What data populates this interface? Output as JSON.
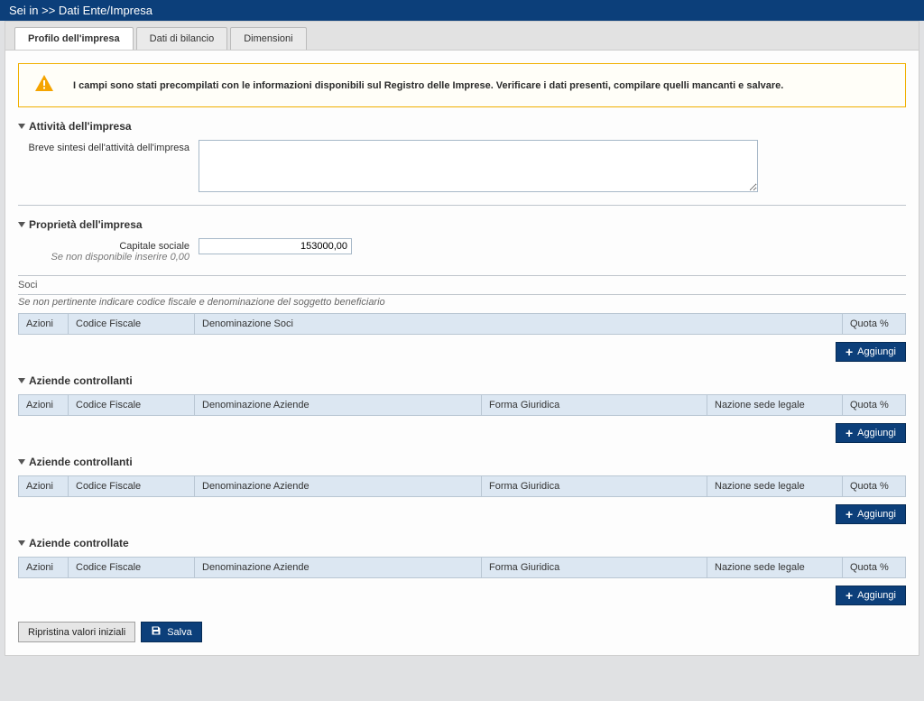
{
  "header": {
    "breadcrumb": "Sei in >> Dati Ente/Impresa"
  },
  "tabs": {
    "profilo": "Profilo dell'impresa",
    "dati": "Dati di bilancio",
    "dimensioni": "Dimensioni"
  },
  "info": {
    "text": "I campi sono stati precompilati con le informazioni disponibili sul Registro delle Imprese. Verificare i dati presenti, compilare quelli mancanti e salvare."
  },
  "section_attivita": {
    "title": "Attività dell'impresa",
    "field_label": "Breve sintesi dell'attività dell'impresa",
    "field_value": ""
  },
  "section_proprieta": {
    "title": "Proprietà dell'impresa",
    "capitale_label": "Capitale sociale",
    "capitale_helper": "Se non disponibile inserire 0,00",
    "capitale_value": "153000,00"
  },
  "section_soci": {
    "title": "Soci",
    "note": "Se non pertinente indicare codice fiscale e denominazione del soggetto beneficiario",
    "cols": {
      "azioni": "Azioni",
      "cf": "Codice Fiscale",
      "denom": "Denominazione Soci",
      "quota": "Quota %"
    }
  },
  "section_controllanti1": {
    "title": "Aziende controllanti",
    "cols": {
      "azioni": "Azioni",
      "cf": "Codice Fiscale",
      "denom": "Denominazione Aziende",
      "forma": "Forma Giuridica",
      "nazione": "Nazione sede legale",
      "quota": "Quota %"
    }
  },
  "section_controllanti2": {
    "title": "Aziende controllanti",
    "cols": {
      "azioni": "Azioni",
      "cf": "Codice Fiscale",
      "denom": "Denominazione Aziende",
      "forma": "Forma Giuridica",
      "nazione": "Nazione sede legale",
      "quota": "Quota %"
    }
  },
  "section_controllate": {
    "title": "Aziende controllate",
    "cols": {
      "azioni": "Azioni",
      "cf": "Codice Fiscale",
      "denom": "Denominazione Aziende",
      "forma": "Forma Giuridica",
      "nazione": "Nazione sede legale",
      "quota": "Quota %"
    }
  },
  "buttons": {
    "aggiungi": "Aggiungi",
    "ripristina": "Ripristina valori iniziali",
    "salva": "Salva"
  }
}
